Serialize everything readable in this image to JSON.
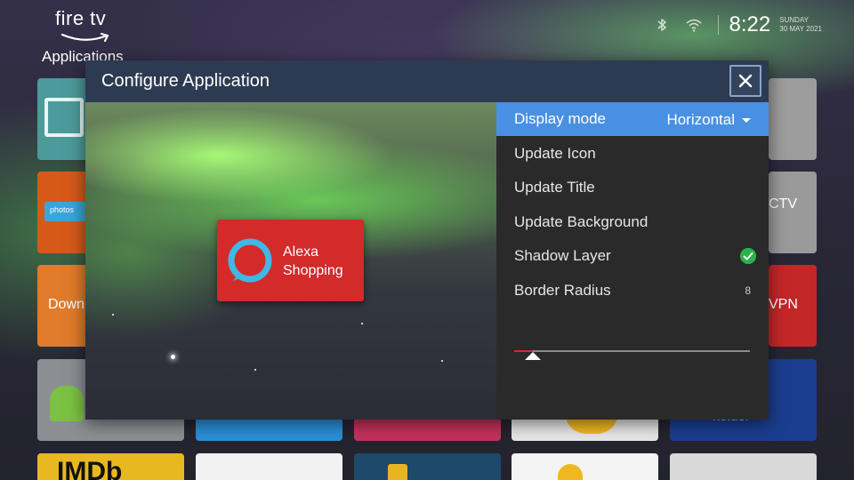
{
  "brand": {
    "name": "fire tv"
  },
  "section_title": "Applications",
  "status_bar": {
    "time": "8:22",
    "day": "SUNDAY",
    "date": "30 MAY 2021",
    "icons": [
      "bluetooth-icon",
      "wifi-icon"
    ]
  },
  "background_tiles": {
    "photos_label": "photos",
    "downloader_label": "Down",
    "cctv_label": "CTV",
    "vpn_label": "VPN",
    "imdb_label": "IMDb",
    "extra_label": "holder"
  },
  "dialog": {
    "title": "Configure Application",
    "close_icon": "close-icon",
    "preview": {
      "app_title_line1": "Alexa",
      "app_title_line2": "Shopping",
      "app_card_color": "#d32a2a"
    },
    "menu": {
      "display_mode_label": "Display mode",
      "display_mode_value": "Horizontal",
      "update_icon_label": "Update Icon",
      "update_title_label": "Update Title",
      "update_background_label": "Update Background",
      "shadow_layer_label": "Shadow Layer",
      "shadow_layer_enabled": true,
      "border_radius_label": "Border Radius",
      "border_radius_value": "8",
      "border_radius_fraction": 0.08
    }
  },
  "colors": {
    "accent": "#4a90e2",
    "header": "#2d3b52",
    "slider_fill": "#d32a2a",
    "check": "#2bb24c"
  }
}
